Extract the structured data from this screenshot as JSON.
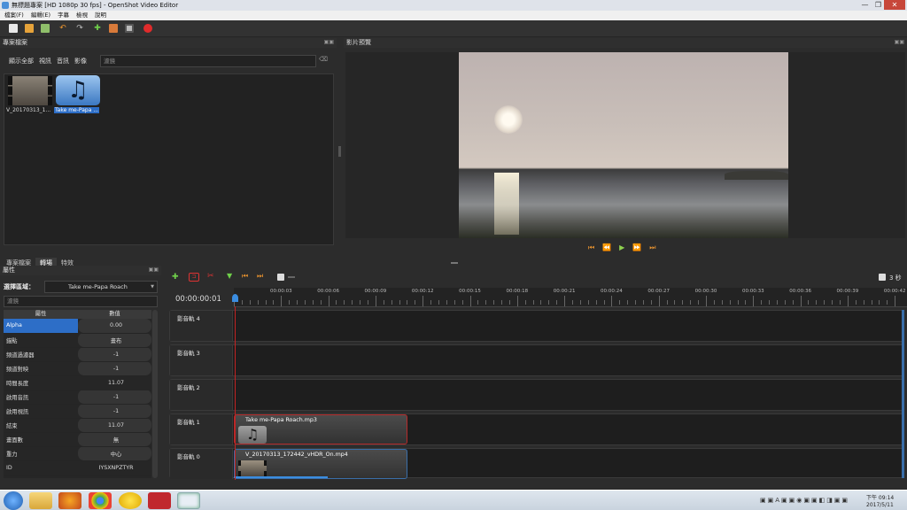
{
  "window": {
    "title": "無標題專案 [HD 1080p 30 fps] - OpenShot Video Editor"
  },
  "menu": [
    "檔案(F)",
    "編輯(E)",
    "字幕",
    "檢視",
    "說明"
  ],
  "project_files": {
    "panel_title": "專案檔案",
    "filter_tabs": [
      "顯示全部",
      "視訊",
      "音訊",
      "影像"
    ],
    "filter_placeholder": "濾鏡",
    "files": [
      {
        "name": "V_20170313_1...",
        "type": "video"
      },
      {
        "name": "Take me-Papa ...",
        "type": "audio",
        "selected": true
      }
    ],
    "bottom_tabs": [
      "專案檔案",
      "轉場",
      "特效"
    ]
  },
  "preview": {
    "panel_title": "影片預覽"
  },
  "properties": {
    "panel_title": "屬性",
    "selection_label": "選擇區域：",
    "selection_value": "Take me-Papa Roach",
    "filter_placeholder": "濾鏡",
    "col_property": "屬性",
    "col_value": "數值",
    "rows": [
      {
        "name": "Alpha",
        "value": "0.00",
        "selected": true
      },
      {
        "name": "錨點",
        "value": "畫布"
      },
      {
        "name": "頻道過濾器",
        "value": "-1"
      },
      {
        "name": "頻道對映",
        "value": "-1"
      },
      {
        "name": "時間長度",
        "value": "11.07"
      },
      {
        "name": "啟用音訊",
        "value": "-1"
      },
      {
        "name": "啟用視訊",
        "value": "-1"
      },
      {
        "name": "結束",
        "value": "11.07"
      },
      {
        "name": "畫面數",
        "value": "無"
      },
      {
        "name": "重力",
        "value": "中心"
      },
      {
        "name": "ID",
        "value": "IYSXNPZTYR"
      }
    ]
  },
  "timeline": {
    "timecode": "00:00:00:01",
    "zoom_label": "3 秒",
    "ruler_labels": [
      "00:00:03",
      "00:00:06",
      "00:00:09",
      "00:00:12",
      "00:00:15",
      "00:00:18",
      "00:00:21",
      "00:00:24",
      "00:00:27",
      "00:00:30",
      "00:00:33",
      "00:00:36",
      "00:00:39",
      "00:00:42"
    ],
    "tracks": [
      {
        "label": "影音軌 4"
      },
      {
        "label": "影音軌 3"
      },
      {
        "label": "影音軌 2"
      },
      {
        "label": "影音軌 1",
        "clip": "Take me-Papa Roach.mp3"
      },
      {
        "label": "影音軌 0",
        "clip": "V_20170313_172442_vHDR_On.mp4"
      }
    ]
  },
  "taskbar": {
    "time": "下午 09:14",
    "date": "2017/5/11"
  }
}
